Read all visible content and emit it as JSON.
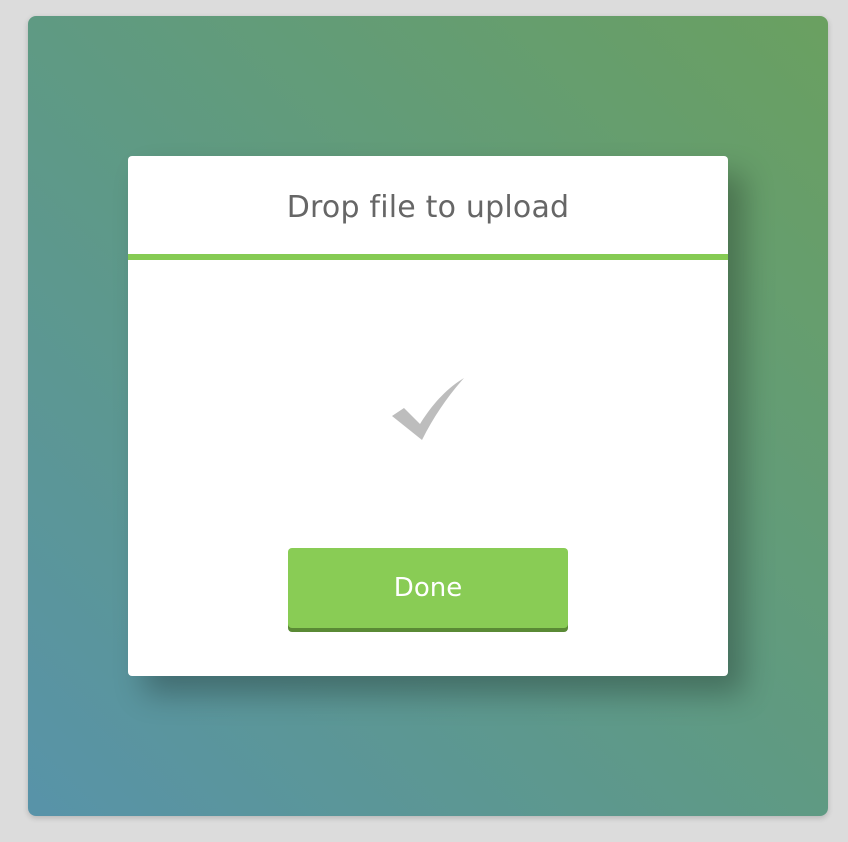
{
  "modal": {
    "title": "Drop file to upload",
    "status_icon": "checkmark-icon",
    "done_label": "Done"
  },
  "colors": {
    "accent": "#89cc55",
    "accent_shadow": "#5a8a35",
    "title_text": "#666666",
    "check_icon": "#bdbdbd",
    "background_gradient_start": "#5893a9",
    "background_gradient_end": "#6aa060"
  }
}
